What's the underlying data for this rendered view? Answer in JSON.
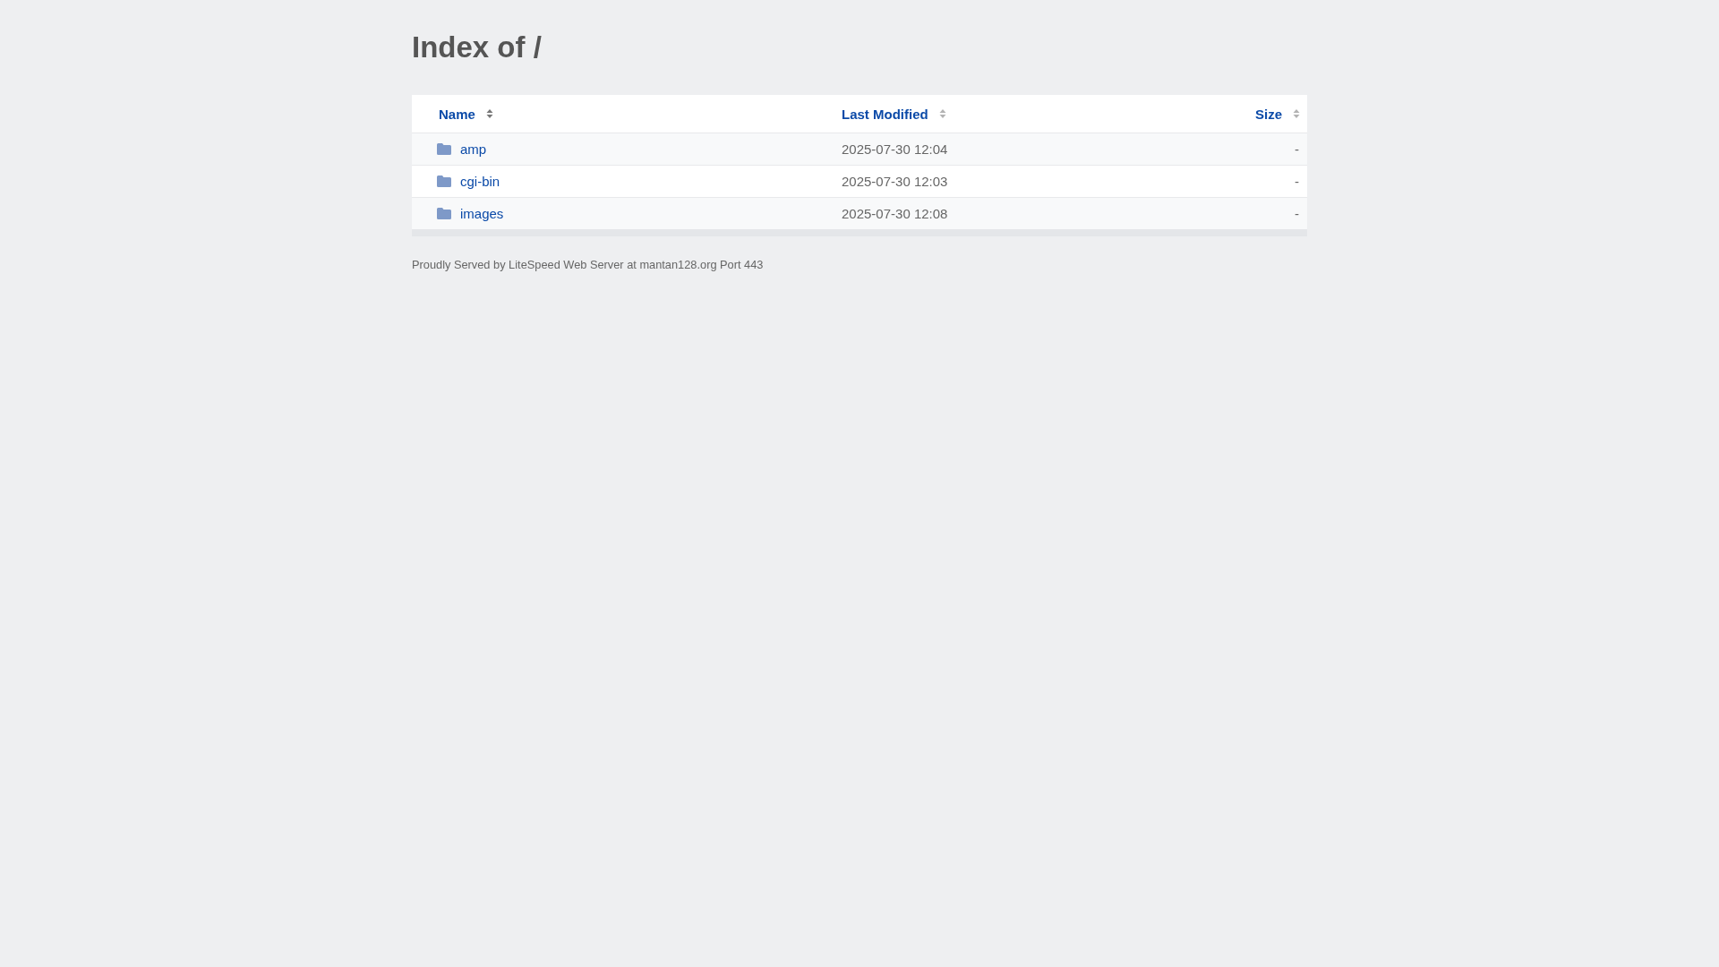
{
  "title": "Index of /",
  "table": {
    "columns": [
      {
        "label": "Name",
        "sorted": true
      },
      {
        "label": "Last Modified",
        "sorted": false
      },
      {
        "label": "Size",
        "sorted": false
      }
    ],
    "rows": [
      {
        "kind": "folder",
        "name": "amp",
        "modified": "2025-07-30 12:04",
        "size": "-"
      },
      {
        "kind": "folder",
        "name": "cgi-bin",
        "modified": "2025-07-30 12:03",
        "size": "-"
      },
      {
        "kind": "folder",
        "name": "images",
        "modified": "2025-07-30 12:08",
        "size": "-"
      }
    ]
  },
  "footer": "Proudly Served by LiteSpeed Web Server at mantan128.org Port 443"
}
